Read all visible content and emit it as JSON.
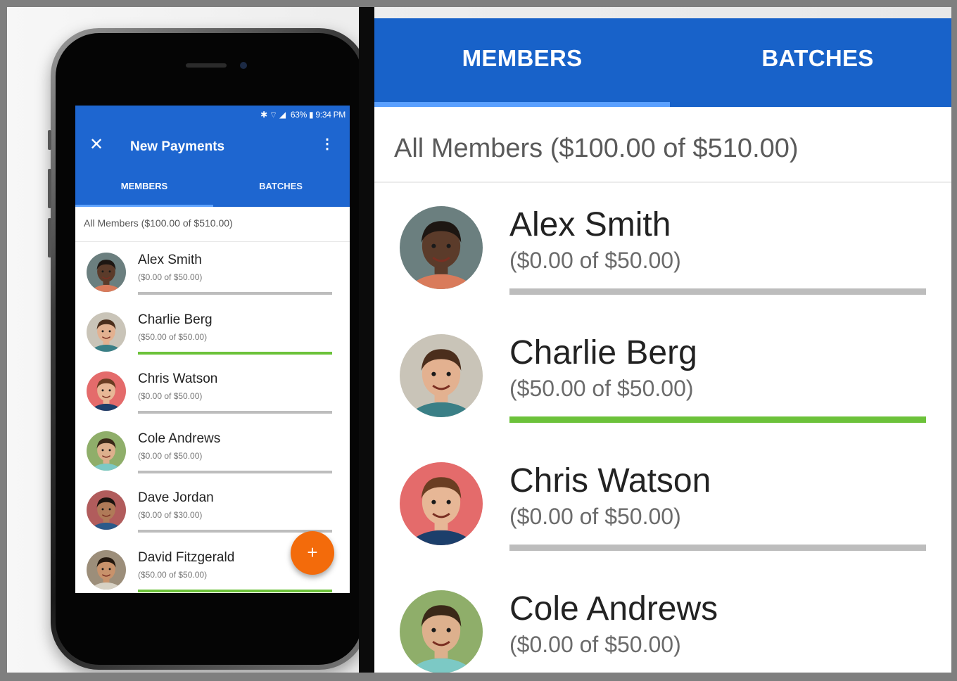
{
  "phone": {
    "status": {
      "icons": "✱ ⌔ ◢",
      "battery": "63%",
      "time": "9:34 PM"
    },
    "appbar": {
      "close_icon": "close-icon",
      "title": "New Payments",
      "more_icon": "more-vert-icon"
    },
    "tabs": [
      {
        "label": "MEMBERS",
        "active": true
      },
      {
        "label": "BATCHES",
        "active": false
      }
    ],
    "summary": "All Members ($100.00 of $510.00)",
    "members": [
      {
        "name": "Alex Smith",
        "amount": "($0.00 of $50.00)",
        "progress": 0,
        "bg": "#6b7f7f",
        "skin": "#5b3b2a",
        "hair": "#1d1612",
        "shirt": "#d97b5b"
      },
      {
        "name": "Charlie Berg",
        "amount": "($50.00 of $50.00)",
        "progress": 1,
        "bg": "#c9c4b8",
        "skin": "#e3b190",
        "hair": "#4b2e1c",
        "shirt": "#3a7f86"
      },
      {
        "name": "Chris Watson",
        "amount": "($0.00 of $50.00)",
        "progress": 0,
        "bg": "#e46b6b",
        "skin": "#e7b796",
        "hair": "#6a3d22",
        "shirt": "#1c3f6b"
      },
      {
        "name": "Cole Andrews",
        "amount": "($0.00 of $50.00)",
        "progress": 0,
        "bg": "#8fae6a",
        "skin": "#ddb08d",
        "hair": "#3a2818",
        "shirt": "#7cc9c5"
      },
      {
        "name": "Dave Jordan",
        "amount": "($0.00 of $30.00)",
        "progress": 0,
        "bg": "#b15c5c",
        "skin": "#b07a58",
        "hair": "#1b130f",
        "shirt": "#2b5a8a"
      },
      {
        "name": "David Fitzgerald",
        "amount": "($50.00 of $50.00)",
        "progress": 1,
        "bg": "#9c8e7a",
        "skin": "#c8926b",
        "hair": "#23180f",
        "shirt": "#d7d1c4"
      }
    ],
    "fab_label": "+",
    "accent": "#1e66d0",
    "fab_color": "#f36b0b"
  },
  "panel": {
    "tabs": [
      {
        "label": "MEMBERS",
        "active": true
      },
      {
        "label": "BATCHES",
        "active": false
      }
    ],
    "summary": "All Members ($100.00 of $510.00)",
    "members": [
      {
        "name": "Alex Smith",
        "amount": "($0.00 of $50.00)",
        "progress": 0
      },
      {
        "name": "Charlie Berg",
        "amount": "($50.00 of $50.00)",
        "progress": 1
      },
      {
        "name": "Chris Watson",
        "amount": "($0.00 of $50.00)",
        "progress": 0
      },
      {
        "name": "Cole Andrews",
        "amount": "($0.00 of $50.00)",
        "progress": 0
      }
    ],
    "accent": "#1862c9",
    "progress_color": "#6cc23a"
  }
}
